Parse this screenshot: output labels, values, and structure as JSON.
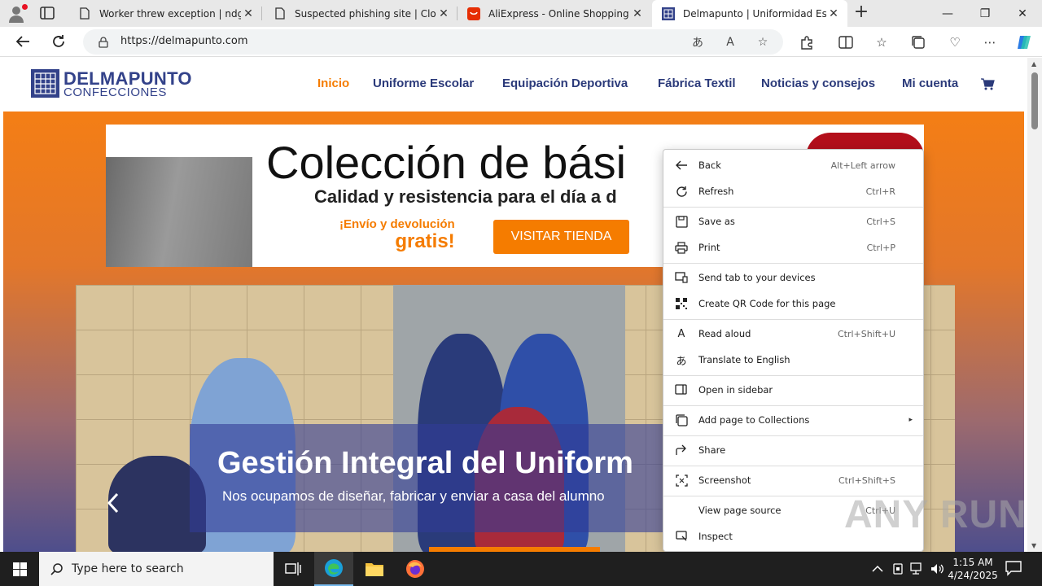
{
  "browser": {
    "tabs": [
      {
        "label": "Worker threw exception | ndgadf",
        "icon": "page-icon"
      },
      {
        "label": "Suspected phishing site | Cloudfl",
        "icon": "page-icon"
      },
      {
        "label": "AliExpress - Online Shopping für",
        "icon": "aliexpress-icon"
      },
      {
        "label": "Delmapunto | Uniformidad Escol",
        "icon": "delmapunto-favicon"
      }
    ],
    "url": "https://delmapunto.com",
    "window_controls": {
      "minimize": "—",
      "restore": "❐",
      "close": "✕"
    }
  },
  "site": {
    "logo_name": "DELMAPUNTO",
    "logo_sub": "CONFECCIONES",
    "nav": [
      {
        "label": "Inicio",
        "active": true
      },
      {
        "label": "Uniforme Escolar",
        "active": false
      },
      {
        "label": "Equipación Deportiva",
        "active": false
      },
      {
        "label": "Fábrica Textil",
        "active": false
      },
      {
        "label": "Noticias y consejos",
        "active": false
      },
      {
        "label": "Mi cuenta",
        "active": false
      }
    ],
    "banner": {
      "title": "Colección de bási",
      "subtitle": "Calidad y resistencia para el día a d",
      "promo_line1": "¡Envío y devolución",
      "promo_line2": "gratis!",
      "button": "VISITAR TIENDA"
    },
    "hero": {
      "title": "Gestión Integral del Uniform",
      "subtitle": "Nos ocupamos de diseñar, fabricar y enviar a casa del alumno"
    }
  },
  "context_menu": {
    "items": [
      {
        "label": "Back",
        "shortcut": "Alt+Left arrow",
        "icon": "back-arrow-icon"
      },
      {
        "label": "Refresh",
        "shortcut": "Ctrl+R",
        "icon": "refresh-icon"
      },
      {
        "label": "Save as",
        "shortcut": "Ctrl+S",
        "icon": "save-icon"
      },
      {
        "label": "Print",
        "shortcut": "Ctrl+P",
        "icon": "print-icon"
      },
      {
        "label": "Send tab to your devices",
        "shortcut": "",
        "icon": "send-tab-icon"
      },
      {
        "label": "Create QR Code for this page",
        "shortcut": "",
        "icon": "qr-code-icon"
      },
      {
        "label": "Read aloud",
        "shortcut": "Ctrl+Shift+U",
        "icon": "read-aloud-icon"
      },
      {
        "label": "Translate to English",
        "shortcut": "",
        "icon": "translate-icon"
      },
      {
        "label": "Open in sidebar",
        "shortcut": "",
        "icon": "sidebar-icon"
      },
      {
        "label": "Add page to Collections",
        "shortcut": "",
        "icon": "collections-icon",
        "submenu": "▸"
      },
      {
        "label": "Share",
        "shortcut": "",
        "icon": "share-icon"
      },
      {
        "label": "Screenshot",
        "shortcut": "Ctrl+Shift+S",
        "icon": "screenshot-icon"
      },
      {
        "label": "View page source",
        "shortcut": "Ctrl+U",
        "icon": ""
      },
      {
        "label": "Inspect",
        "shortcut": "",
        "icon": "inspect-icon"
      }
    ]
  },
  "watermark": "ANY RUN",
  "taskbar": {
    "search_placeholder": "Type here to search",
    "time": "1:15 AM",
    "date": "4/24/2025"
  }
}
